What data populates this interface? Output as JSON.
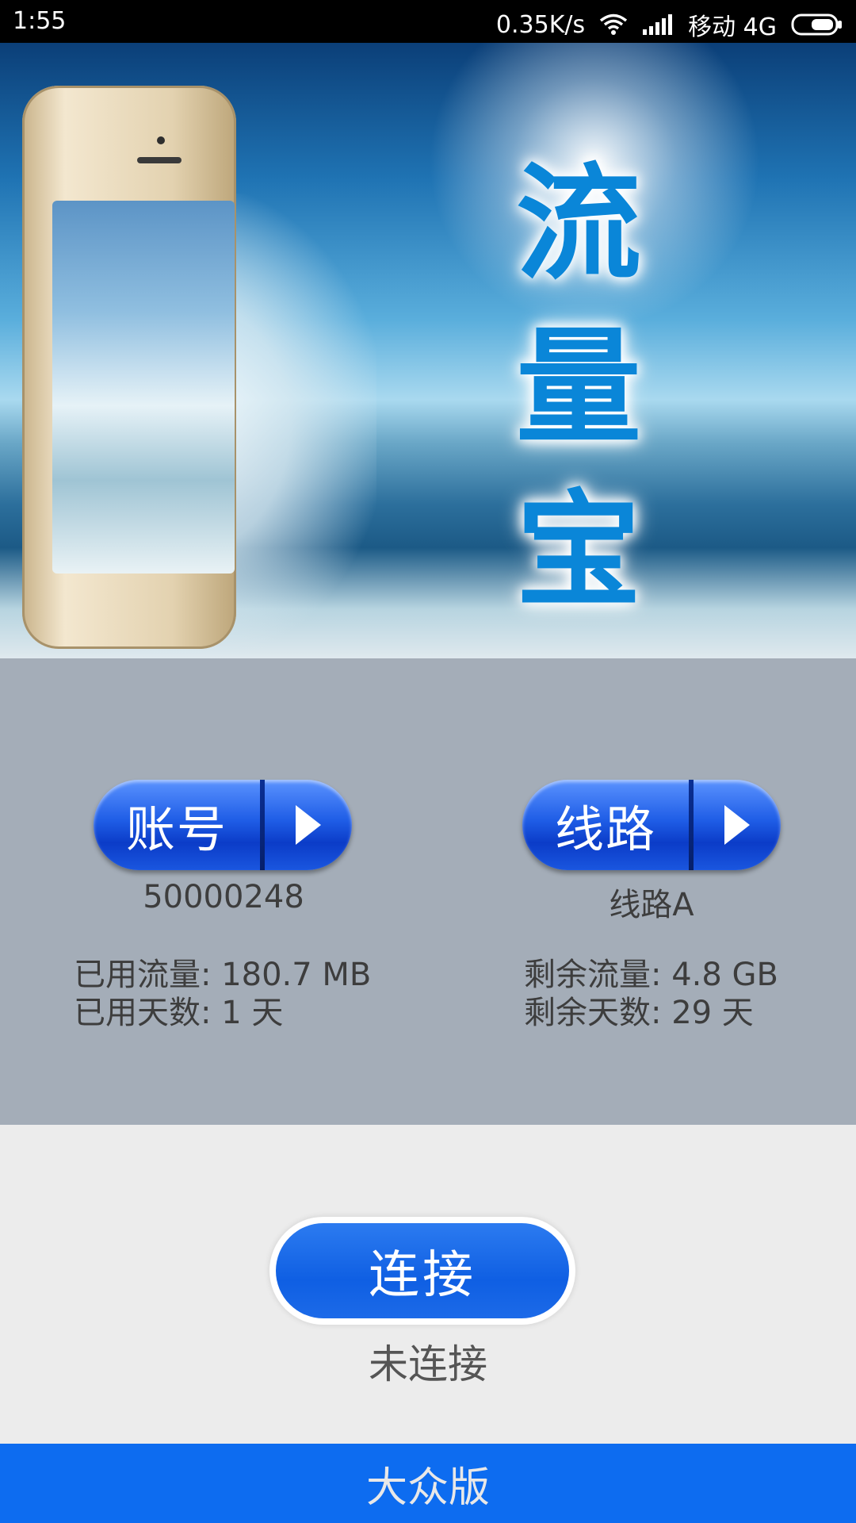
{
  "status_bar": {
    "time": "1:55",
    "net_speed": "0.35K/s",
    "carrier": "移动 4G",
    "icons": [
      "wifi-icon",
      "signal-icon",
      "battery-icon"
    ]
  },
  "banner": {
    "title_chars": [
      "流",
      "量",
      "宝"
    ]
  },
  "account": {
    "button_label": "账号",
    "value": "50000248"
  },
  "route": {
    "button_label": "线路",
    "value": "线路A"
  },
  "stats": {
    "used_traffic": "已用流量: 180.7 MB",
    "used_days": "已用天数: 1 天",
    "remaining_traffic": "剩余流量: 4.8 GB",
    "remaining_days": "剩余天数: 29 天"
  },
  "connect": {
    "button_label": "连接",
    "status": "未连接"
  },
  "bottom_bar": {
    "label": "大众版"
  },
  "colors": {
    "accent": "#0d6cf0",
    "panel": "#a4adb8",
    "title_blue": "#0a86d8"
  }
}
